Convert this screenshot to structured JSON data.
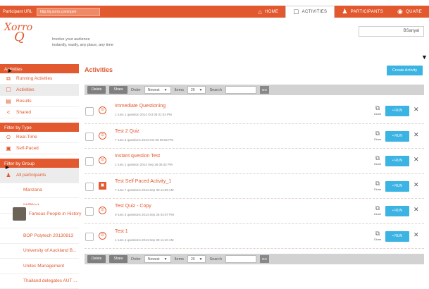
{
  "topbar": {
    "participant_label": "Participant URL",
    "participant_url": "http://q.xorro.com/npeh",
    "nav": [
      {
        "icon": "⌂",
        "label": "Home"
      },
      {
        "icon": "☐",
        "label": "Activities"
      },
      {
        "icon": "♟",
        "label": "Participants"
      },
      {
        "icon": "◉",
        "label": "Quare"
      }
    ]
  },
  "brand": {
    "logo_top": "Xorro",
    "logo_bottom": "Q",
    "tagline_1": "Involve your audience",
    "tagline_2": "instantly, easily, any place, any time"
  },
  "user": {
    "name": "BSanyal"
  },
  "sidebar": {
    "activities_header": "Activities",
    "activities": [
      {
        "icon": "⧉",
        "label": "Running Activities"
      },
      {
        "icon": "☐",
        "label": "Activities"
      },
      {
        "icon": "▤",
        "label": "Results"
      },
      {
        "icon": "<",
        "label": "Shared"
      }
    ],
    "type_header": "Filter by Type",
    "types": [
      {
        "icon": "⊙",
        "label": "Real-Time"
      },
      {
        "icon": "▣",
        "label": "Self-Paced"
      }
    ],
    "group_header": "Filter by Group",
    "all_participants": "All participants",
    "groups": [
      "Manzana",
      "IWBNet",
      "",
      "BOP Polytech 20130813",
      "University of Auckland B...",
      "Unitec Management",
      "Thailand delegates AUT ..."
    ],
    "tooltip": "Famous People in History"
  },
  "main": {
    "title": "Activities",
    "create_label": "Create Activity",
    "toolbar": {
      "delete": "Delete",
      "share": "Share",
      "order_label": "Order",
      "order_value": "Newest",
      "items_label": "Items",
      "items_value": "20",
      "search_label": "Search",
      "go": "GO"
    },
    "clone_label": "Clone",
    "run_label": "• RUN",
    "delete_icon": "✕",
    "activities": [
      {
        "title": "Immediate Questioning",
        "meta": "1 runs   1 question   2014 Oct 06 01:03 PM",
        "type": "rt"
      },
      {
        "title": "Test 2 Quiz",
        "meta": "7 runs   6 questions   2014 Oct 06 09:52 PM",
        "type": "rt"
      },
      {
        "title": "Instant question  Test",
        "meta": "1 runs   1 question   2014 Sep 26 05:42 PM",
        "type": "rt"
      },
      {
        "title": "Test Self Paced Activity_1",
        "meta": "7 runs   7 questions   2014 Sep 30 11:09 AM",
        "type": "sp"
      },
      {
        "title": "Test Quiz - Copy",
        "meta": "0 runs   3 questions   2014 Sep 26 04:07 PM",
        "type": "rt"
      },
      {
        "title": "Test 1",
        "meta": "1 runs   4 questions   2014 Sep 30 11:10 AM",
        "type": "rt"
      }
    ]
  }
}
